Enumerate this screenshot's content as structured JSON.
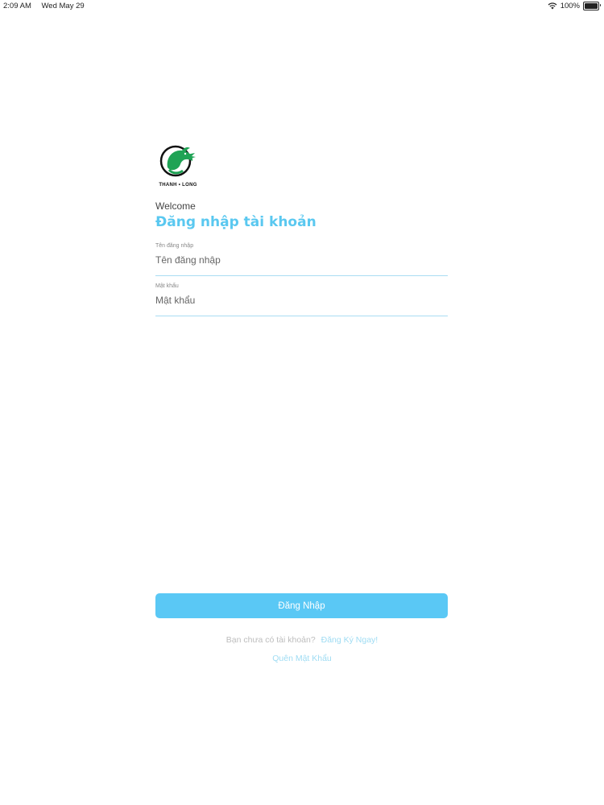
{
  "status_bar": {
    "time": "2:09 AM",
    "date": "Wed May 29",
    "battery_text": "100%",
    "battery_level": 1.0
  },
  "logo": {
    "text": "THANH • LONG",
    "color": "#1fa355",
    "icon": "dragon-logo"
  },
  "login": {
    "welcome": "Welcome",
    "title": "Đăng nhập tài khoản",
    "username": {
      "label": "Tên đăng nhập",
      "placeholder": "Tên đăng nhập",
      "value": ""
    },
    "password": {
      "label": "Mật khẩu",
      "placeholder": "Mật khẩu",
      "value": ""
    },
    "button_label": "Đăng Nhập",
    "signup_prompt": "Bạn chưa có tài khoản?",
    "signup_link": "Đăng Ký Ngay!",
    "forgot_password": "Quên Mật Khẩu"
  },
  "colors": {
    "accent": "#5ac8f5",
    "link": "#9fdcf3"
  }
}
